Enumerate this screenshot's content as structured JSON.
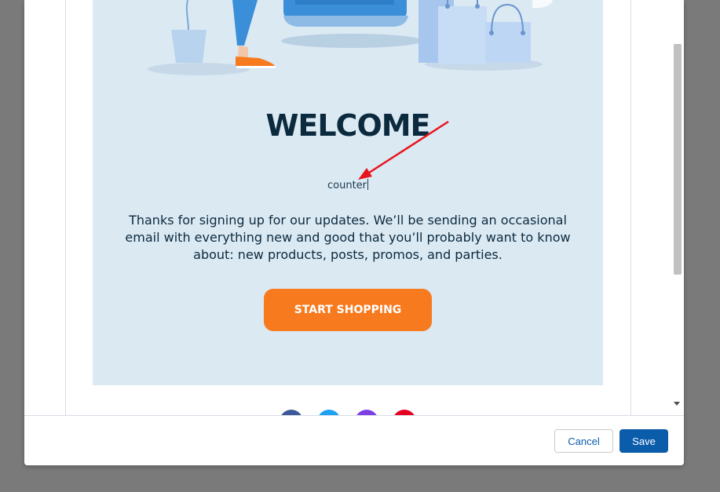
{
  "email": {
    "heading": "WELCOME",
    "counter_text": "counter",
    "body_text": "Thanks for signing up for our updates. We’ll be sending an occasional email with everything new and good that you’ll probably want to know about: new products, posts, promos, and parties.",
    "cta_label": "START SHOPPING",
    "card_background": "#dbe9f3",
    "cta_color": "#f77a1e",
    "heading_color": "#0b2a3e"
  },
  "social": {
    "icons": [
      "facebook-icon",
      "twitter-icon",
      "instagram-icon",
      "pinterest-icon"
    ],
    "colors": [
      "#3b5998",
      "#1da1f2",
      "#7b3fe4",
      "#e60023"
    ]
  },
  "annotation": {
    "arrow_color": "#e8141c"
  },
  "footer": {
    "cancel_label": "Cancel",
    "save_label": "Save"
  },
  "colors": {
    "overlay": "#7a7a7a",
    "primary": "#0b5cab"
  }
}
